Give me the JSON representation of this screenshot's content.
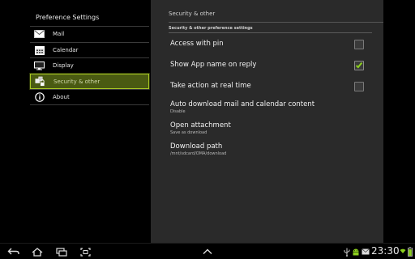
{
  "sidebar": {
    "title": "Preference Settings",
    "items": [
      {
        "label": "Mail",
        "icon": "mail-icon"
      },
      {
        "label": "Calendar",
        "icon": "calendar-icon"
      },
      {
        "label": "Display",
        "icon": "display-icon"
      },
      {
        "label": "Security & other",
        "icon": "security-icon",
        "active": true
      },
      {
        "label": "About",
        "icon": "info-icon"
      }
    ]
  },
  "panel": {
    "header": "Security & other",
    "section_title": "Security & other preference settings",
    "prefs": [
      {
        "title": "Access with pin",
        "checked": false
      },
      {
        "title": "Show App name on reply",
        "checked": true
      },
      {
        "title": "Take action at real time",
        "checked": false
      },
      {
        "title": "Auto download mail and calendar content",
        "summary": "Disable"
      },
      {
        "title": "Open attachment",
        "summary": "Save as download"
      },
      {
        "title": "Download path",
        "summary": "/mnt/sdcard/OMA/download"
      }
    ]
  },
  "navbar": {
    "time": "23:30",
    "buttons": [
      "back-icon",
      "home-icon",
      "recent-apps-icon",
      "screenshot-icon",
      "menu-up-icon"
    ],
    "status_icons": [
      "usb-icon",
      "android-debug-icon",
      "email-notification-icon",
      "battery-icon",
      "wifi-icon"
    ]
  },
  "colors": {
    "accent": "#a8c824",
    "check": "#8ccf1e",
    "panel_bg": "#2a2a2a"
  }
}
